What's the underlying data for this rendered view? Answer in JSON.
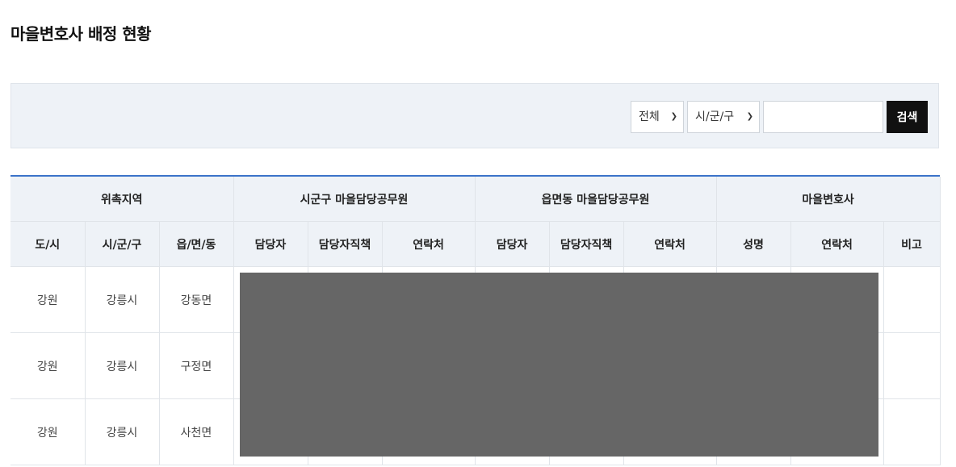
{
  "page": {
    "title": "마을변호사 배정 현황"
  },
  "search": {
    "filter_all": "전체",
    "filter_city": "시/군/구",
    "input_value": "",
    "button_label": "검색"
  },
  "table": {
    "group_headers": [
      {
        "label": "위촉지역",
        "colspan": 3
      },
      {
        "label": "시군구 마을담당공무원",
        "colspan": 3
      },
      {
        "label": "읍면동 마을담당공무원",
        "colspan": 3
      },
      {
        "label": "마을변호사",
        "colspan": 3
      }
    ],
    "columns": [
      "도/시",
      "시/군/구",
      "읍/면/동",
      "담당자",
      "담당자직책",
      "연락처",
      "담당자",
      "담당자직책",
      "연락처",
      "성명",
      "연락처",
      "비고"
    ],
    "rows": [
      [
        "강원",
        "강릉시",
        "강동면",
        "",
        "",
        "",
        "",
        "",
        "",
        "",
        "",
        ""
      ],
      [
        "강원",
        "강릉시",
        "구정면",
        "",
        "",
        "",
        "",
        "",
        "",
        "",
        "",
        ""
      ],
      [
        "강원",
        "강릉시",
        "사천면",
        "",
        "",
        "",
        "",
        "",
        "",
        "",
        "",
        ""
      ]
    ]
  },
  "icons": {
    "dropdown": "chevron-down-icon"
  },
  "colors": {
    "accent": "#3b73c9",
    "header_bg": "#eef2f7",
    "button_bg": "#111111",
    "redaction": "#666666"
  }
}
